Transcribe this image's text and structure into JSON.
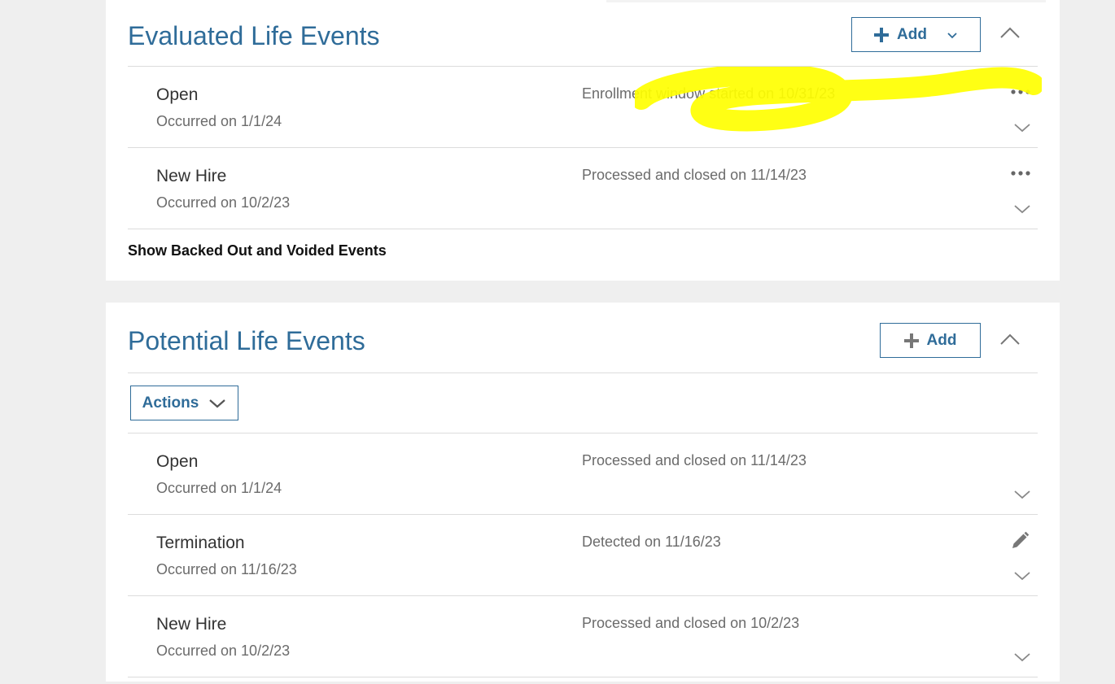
{
  "evaluated": {
    "title": "Evaluated Life Events",
    "add_label": "Add",
    "show_link": "Show Backed Out and Voided Events",
    "rows": [
      {
        "name": "Open",
        "occurred": "Occurred on 1/1/24",
        "status": "Enrollment window started on 10/31/23"
      },
      {
        "name": "New Hire",
        "occurred": "Occurred on 10/2/23",
        "status": "Processed and closed on 11/14/23"
      }
    ]
  },
  "potential": {
    "title": "Potential Life Events",
    "add_label": "Add",
    "actions_label": "Actions",
    "rows": [
      {
        "name": "Open",
        "occurred": "Occurred on 1/1/24",
        "status": "Processed and closed on 11/14/23"
      },
      {
        "name": "Termination",
        "occurred": "Occurred on 11/16/23",
        "status": "Detected on 11/16/23"
      },
      {
        "name": "New Hire",
        "occurred": "Occurred on 10/2/23",
        "status": "Processed and closed on 10/2/23"
      }
    ]
  },
  "colors": {
    "accent": "#2f6c99",
    "highlight": "#ffff00",
    "page_background": "#efefef"
  }
}
